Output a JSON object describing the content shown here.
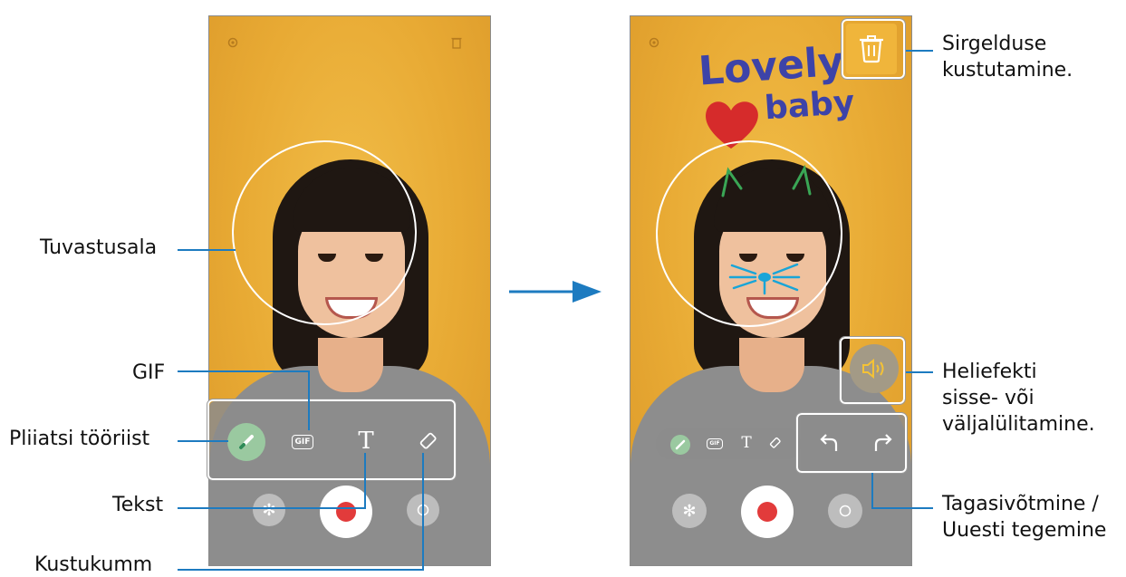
{
  "left_screen": {
    "settings_icon": "gear-icon",
    "delete_icon": "trash-icon",
    "toolbar": {
      "gif_label": "GIF",
      "text_glyph": "T"
    }
  },
  "right_screen": {
    "settings_icon": "gear-icon",
    "doodle": {
      "word1": "Lovely",
      "word2": "baby"
    },
    "toolbar": {
      "gif_label": "GIF",
      "text_glyph": "T"
    }
  },
  "callouts": {
    "tuvastusala": "Tuvastusala",
    "gif": "GIF",
    "pliiatsi": "Pliiatsi tööriist",
    "tekst": "Tekst",
    "kustukumm": "Kustukumm",
    "sirgelduse_1": "Sirgelduse",
    "sirgelduse_2": "kustutamine.",
    "heliefekti_1": "Heliefekti",
    "heliefekti_2": "sisse- või",
    "heliefekti_3": "väljalülitamine.",
    "tagasi_1": "Tagasivõtmine /",
    "tagasi_2": "Uuesti tegemine"
  },
  "colors": {
    "callout_line": "#1d7bc0",
    "record": "#e23b3b",
    "background": "#e9ac35"
  }
}
